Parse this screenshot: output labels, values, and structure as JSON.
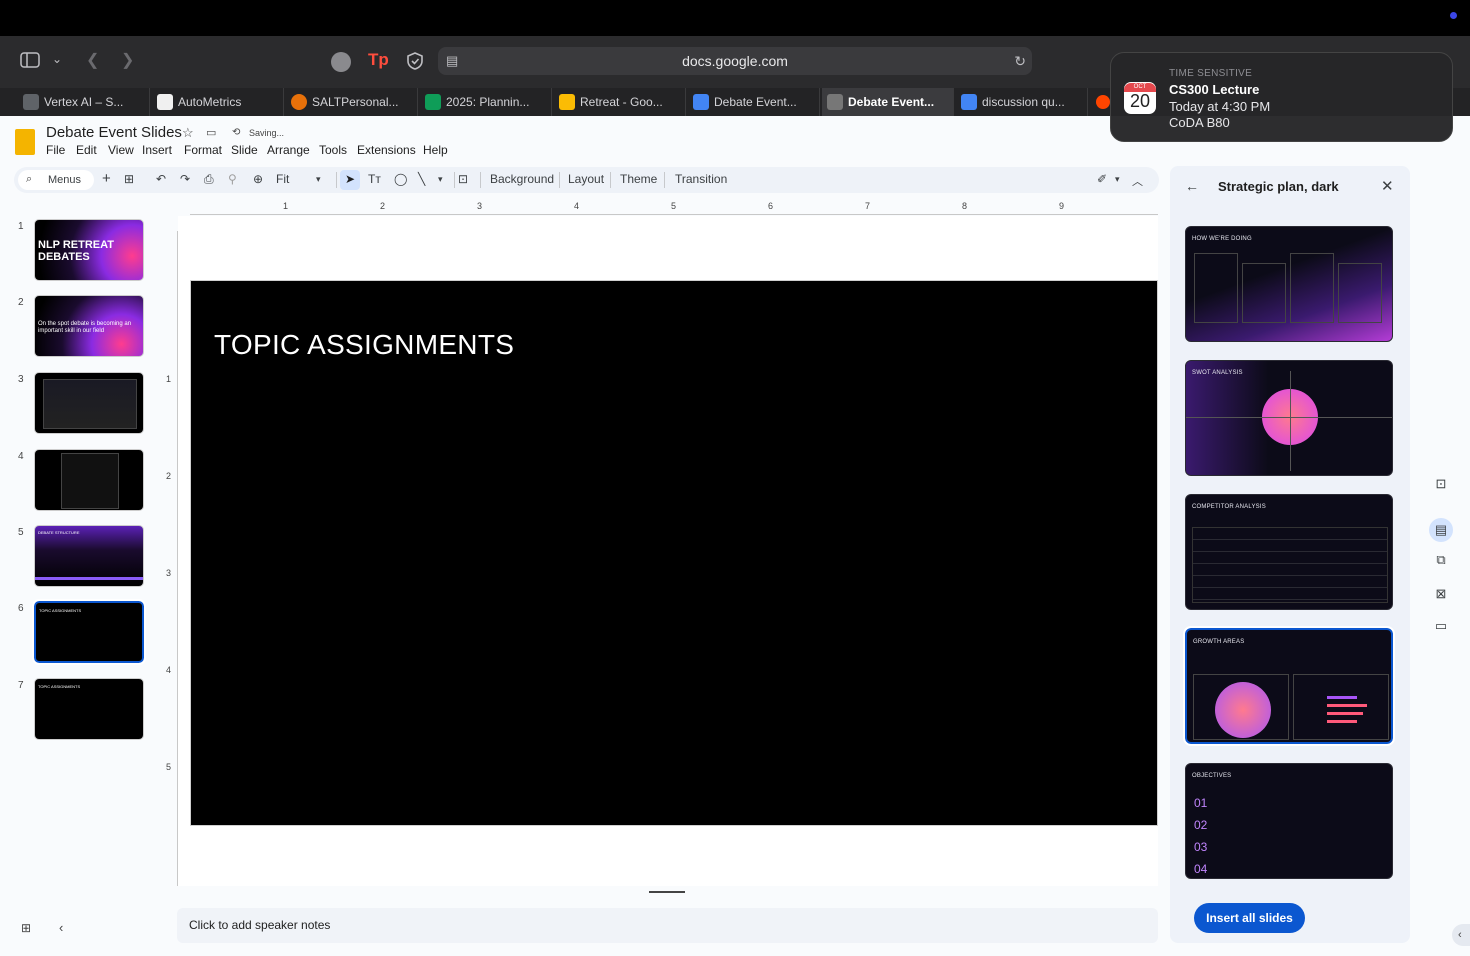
{
  "browser": {
    "url": "docs.google.com",
    "tabs": [
      {
        "label": "Vertex AI – S...",
        "color": "#5f6368"
      },
      {
        "label": "AutoMetrics",
        "color": "#1f1f1f"
      },
      {
        "label": "SALTPersonal...",
        "color": "#e8710a"
      },
      {
        "label": "2025: Plannin...",
        "color": "#0f9d58"
      },
      {
        "label": "Retreat - Goo...",
        "color": "#fbbc04"
      },
      {
        "label": "Debate Event...",
        "color": "#4285f4"
      },
      {
        "label": "Debate Event...",
        "color": "#777777"
      },
      {
        "label": "discussion qu...",
        "color": "#4285f4"
      }
    ]
  },
  "doc": {
    "title": "Debate Event Slides",
    "save_status": "Saving...",
    "menus": [
      "File",
      "Edit",
      "View",
      "Insert",
      "Format",
      "Slide",
      "Arrange",
      "Tools",
      "Extensions",
      "Help"
    ]
  },
  "toolbar": {
    "search_label": "Menus",
    "zoom": "Fit",
    "background": "Background",
    "layout": "Layout",
    "theme": "Theme",
    "transition": "Transition"
  },
  "filmstrip": {
    "slides": [
      {
        "num": "1",
        "title": "NLP RETREAT\nDEBATES"
      },
      {
        "num": "2",
        "title": "On the spot debate is becoming an important skill in our field"
      },
      {
        "num": "3",
        "title": ""
      },
      {
        "num": "4",
        "title": ""
      },
      {
        "num": "5",
        "title": "DEBATE STRUCTURE"
      },
      {
        "num": "6",
        "title": "TOPIC ASSIGNMENTS"
      },
      {
        "num": "7",
        "title": "TOPIC ASSIGNMENTS"
      }
    ]
  },
  "ruler": {
    "h": [
      "1",
      "2",
      "3",
      "4",
      "5",
      "6",
      "7",
      "8",
      "9"
    ],
    "v": [
      "1",
      "2",
      "3",
      "4",
      "5"
    ]
  },
  "slide": {
    "title": "TOPIC ASSIGNMENTS"
  },
  "notes": {
    "placeholder": "Click to add speaker notes"
  },
  "panel": {
    "title": "Strategic plan, dark",
    "templates": [
      {
        "title": "HOW WE'RE DOING"
      },
      {
        "title": "SWOT ANALYSIS"
      },
      {
        "title": "COMPETITOR ANALYSIS"
      },
      {
        "title": "GROWTH AREAS"
      },
      {
        "title": "OBJECTIVES"
      }
    ],
    "insert_all": "Insert all slides"
  },
  "notification": {
    "kind": "TIME SENSITIVE",
    "title": "CS300 Lecture",
    "time": "Today at 4:30 PM",
    "location": "CoDA B80",
    "month": "OCT",
    "day": "20"
  }
}
